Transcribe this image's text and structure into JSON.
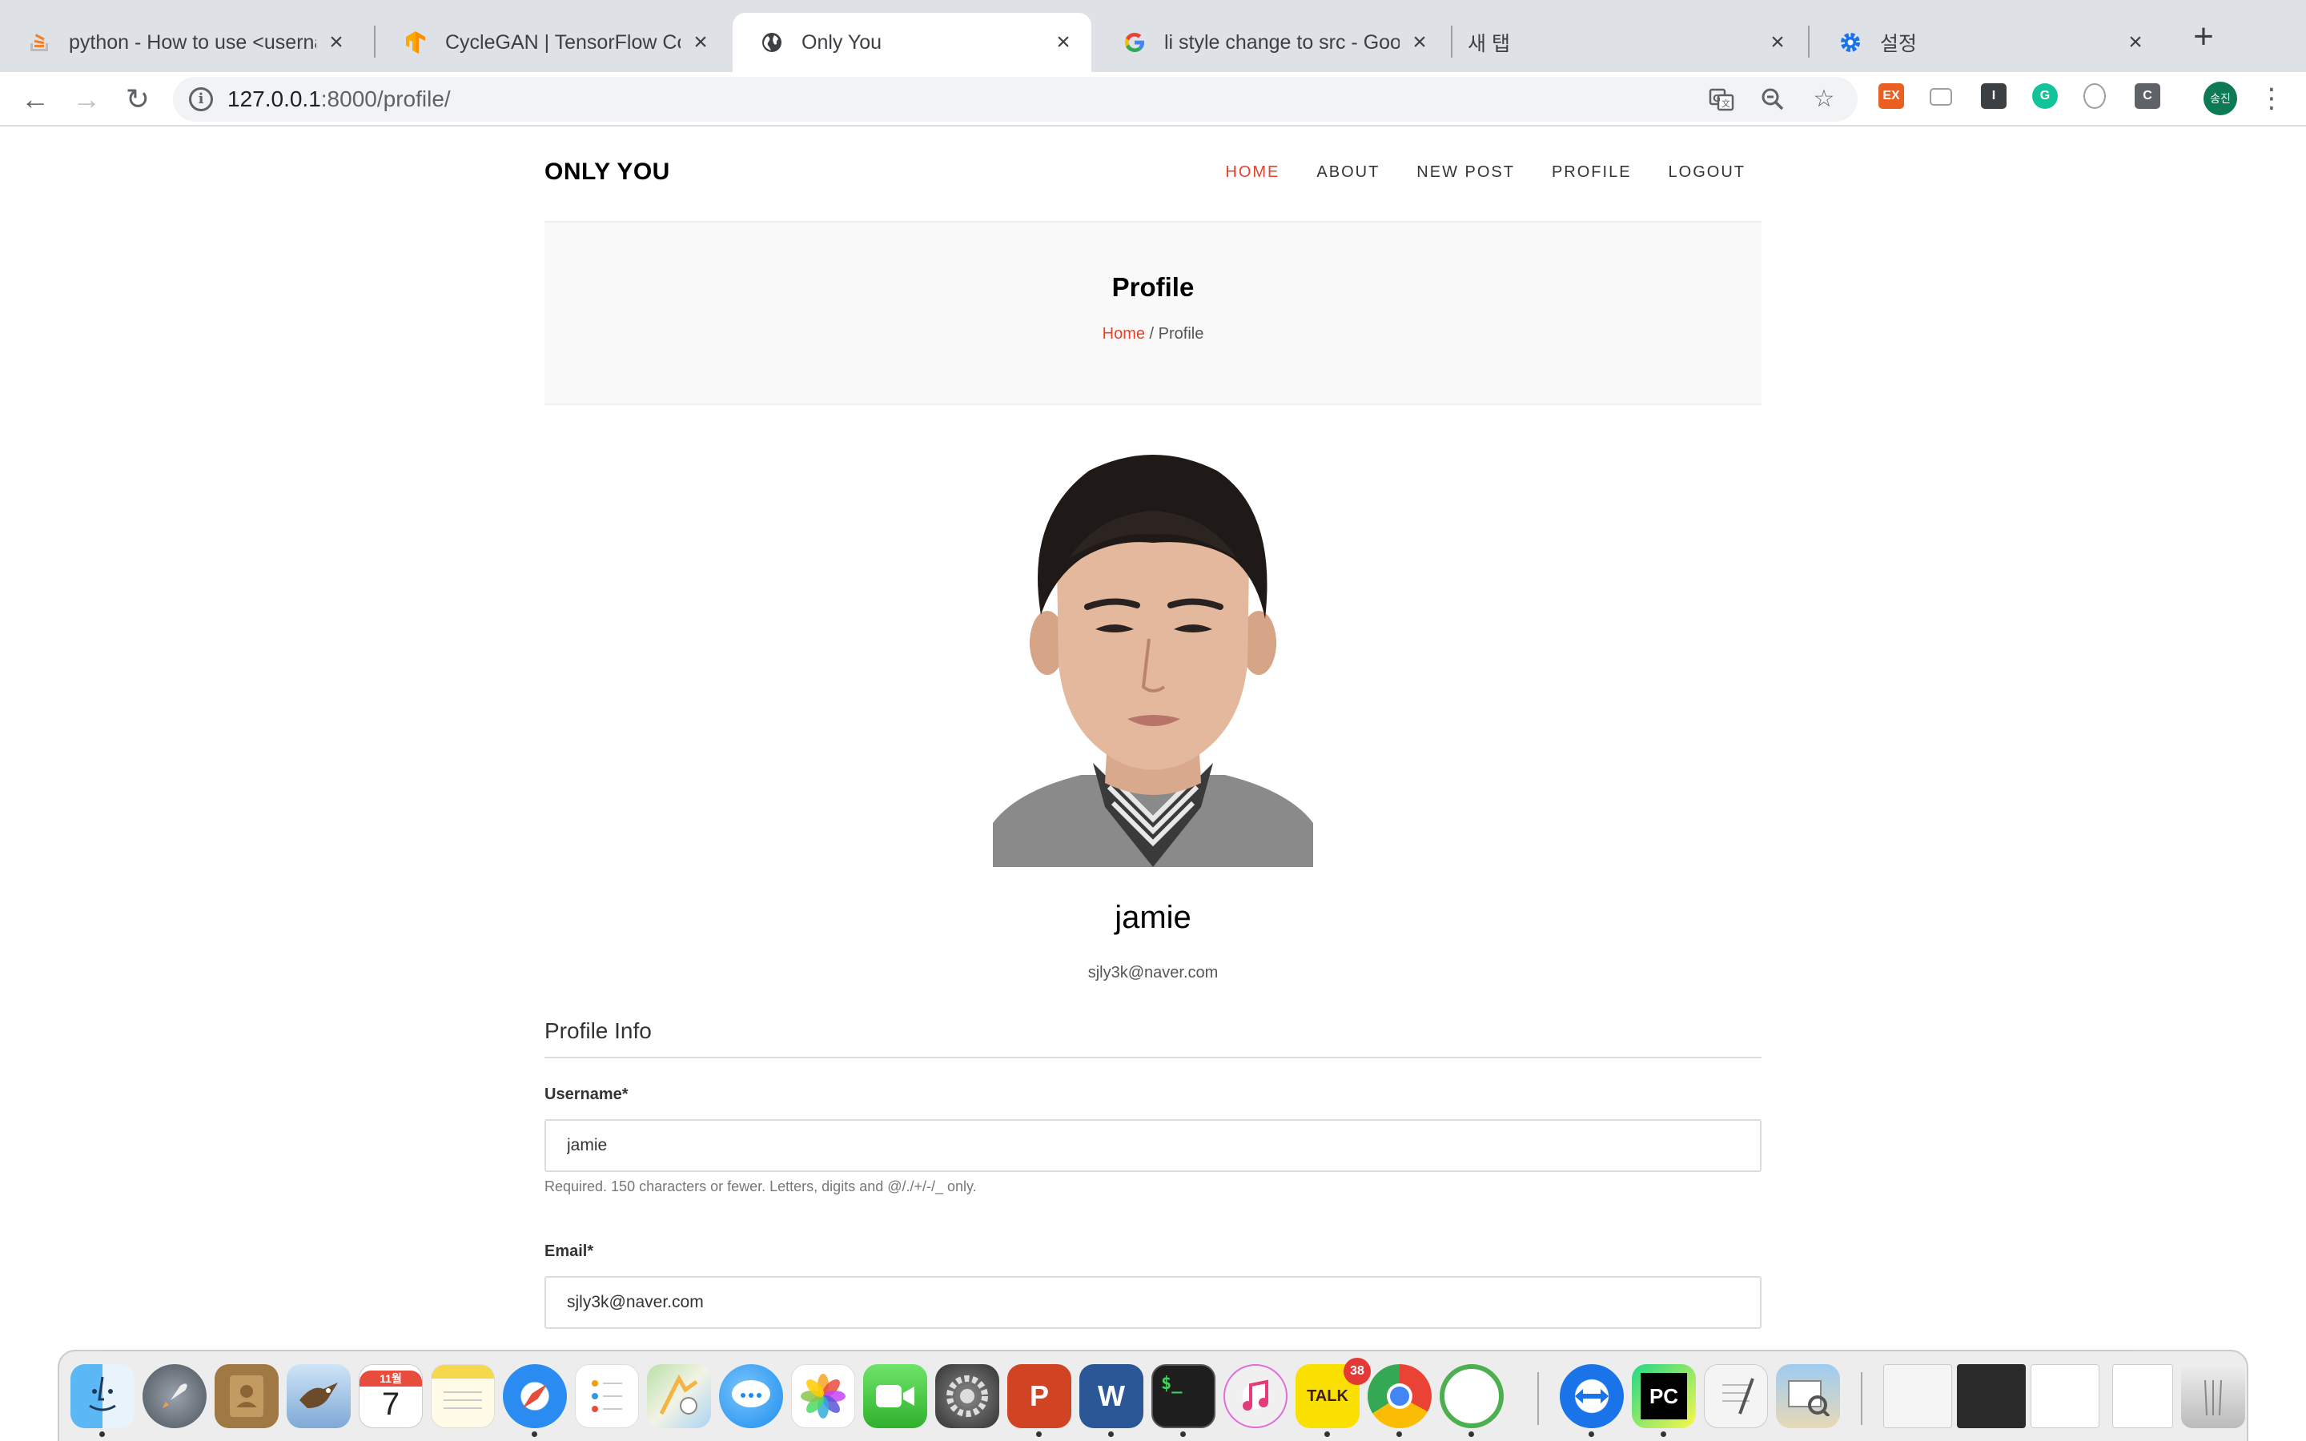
{
  "browser": {
    "tabs": [
      {
        "title": "python - How to use <userna",
        "icon": "stackoverflow-icon",
        "active": false
      },
      {
        "title": "CycleGAN  |  TensorFlow Co",
        "icon": "tensorflow-icon",
        "active": false
      },
      {
        "title": "Only You",
        "icon": "globe-icon",
        "active": true
      },
      {
        "title": "li style change to src - Goog",
        "icon": "google-icon",
        "active": false
      },
      {
        "title": "새 탭",
        "icon": "",
        "active": false
      },
      {
        "title": "설정",
        "icon": "settings-gear-icon",
        "active": false
      }
    ],
    "url_host": "127.0.0.1",
    "url_rest": ":8000/profile/",
    "profile_initials": "송진",
    "extensions": [
      "EX",
      "I",
      "C"
    ]
  },
  "site": {
    "logo": "ONLY YOU",
    "nav": [
      {
        "label": "HOME",
        "active": true
      },
      {
        "label": "ABOUT",
        "active": false
      },
      {
        "label": "NEW POST",
        "active": false
      },
      {
        "label": "PROFILE",
        "active": false
      },
      {
        "label": "LOGOUT",
        "active": false
      }
    ],
    "page_title": "Profile",
    "breadcrumb_home": "Home",
    "breadcrumb_sep": " / ",
    "breadcrumb_current": "Profile"
  },
  "profile": {
    "username": "jamie",
    "email": "sjly3k@naver.com",
    "section_title": "Profile Info",
    "fields": {
      "username_label": "Username*",
      "username_value": "jamie",
      "username_help": "Required. 150 characters or fewer. Letters, digits and @/./+/-/_ only.",
      "email_label": "Email*",
      "email_value": "sjly3k@naver.com"
    }
  },
  "dock": {
    "calendar_month": "11월",
    "calendar_day": "7",
    "kakaotalk_label": "TALK",
    "kakaotalk_badge": "38",
    "word_letter": "W",
    "powerpoint_letter": "P",
    "pycharm_letter": "PC",
    "terminal_prompt": "$_"
  },
  "colors": {
    "accent": "#e5432a",
    "tabstrip": "#dee1e6",
    "hero_bg": "#f9f9f9"
  }
}
